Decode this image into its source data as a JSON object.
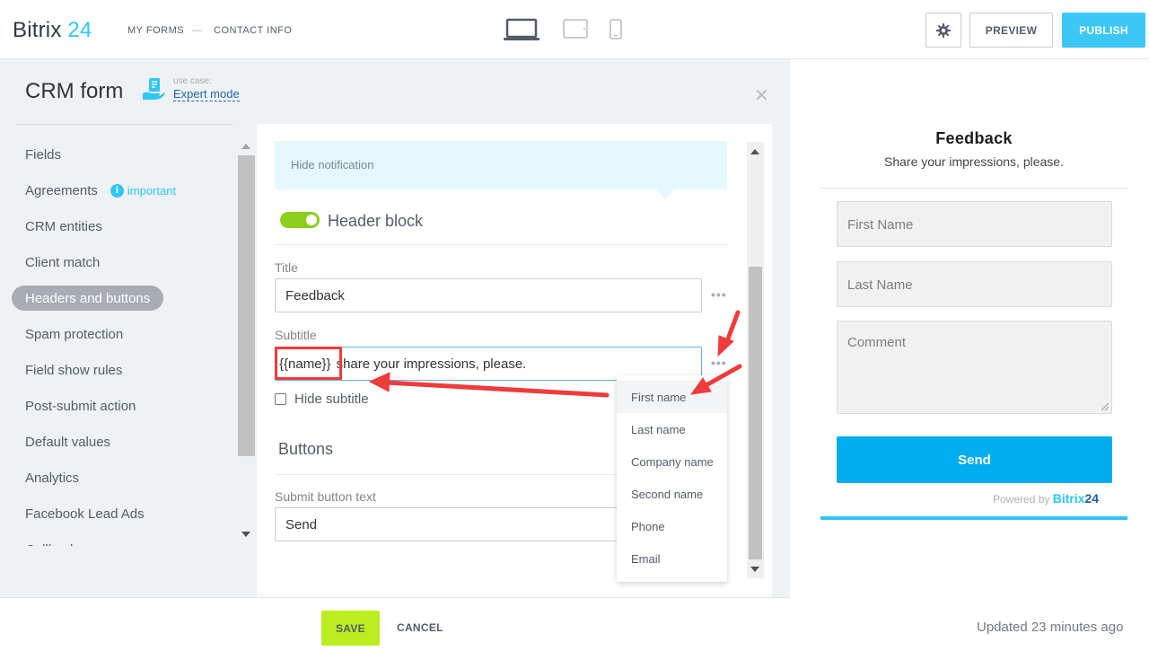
{
  "header": {
    "logo_text": "Bitrix",
    "logo_num": "24",
    "breadcrumbs": [
      "MY FORMS",
      "—",
      "CONTACT INFO"
    ],
    "preview_label": "PREVIEW",
    "publish_label": "PUBLISH"
  },
  "panel": {
    "title": "CRM form",
    "usecase_label": "use case:",
    "usecase_value": "Expert mode"
  },
  "nav": {
    "items": [
      {
        "label": "Fields"
      },
      {
        "label": "Agreements",
        "badge": "important"
      },
      {
        "label": "CRM entities"
      },
      {
        "label": "Client match"
      },
      {
        "label": "Headers and buttons",
        "active": true
      },
      {
        "label": "Spam protection"
      },
      {
        "label": "Field show rules"
      },
      {
        "label": "Post-submit action"
      },
      {
        "label": "Default values"
      },
      {
        "label": "Analytics"
      },
      {
        "label": "Facebook Lead Ads"
      },
      {
        "label": "Callback"
      }
    ]
  },
  "editor": {
    "notification": "Hide notification",
    "header_block": "Header block",
    "title_label": "Title",
    "title_value": "Feedback",
    "subtitle_label": "Subtitle",
    "subtitle_token": "{{name}}",
    "subtitle_value": "share your impressions, please.",
    "hide_subtitle": "Hide subtitle",
    "buttons_heading": "Buttons",
    "submit_label": "Submit button text",
    "submit_value": "Send",
    "menu_dots": "•••"
  },
  "dropdown": {
    "items": [
      "First name",
      "Last name",
      "Company name",
      "Second name",
      "Phone",
      "Email"
    ]
  },
  "footer": {
    "save_label": "SAVE",
    "cancel_label": "CANCEL"
  },
  "preview": {
    "title": "Feedback",
    "subtitle": "Share your impressions, please.",
    "first_name_placeholder": "First Name",
    "last_name_placeholder": "Last Name",
    "comment_placeholder": "Comment",
    "send_label": "Send",
    "powered_by": "Powered by",
    "brand_text": "Bitrix",
    "brand_num": "24",
    "updated": "Updated 23 minutes ago"
  },
  "colors": {
    "accent": "#2fc6f6",
    "publish": "#3bc8f5",
    "save": "#bbed21",
    "toggle_on": "#8ccf1f",
    "send": "#00aeef",
    "annotation": "#ee3b3b"
  }
}
